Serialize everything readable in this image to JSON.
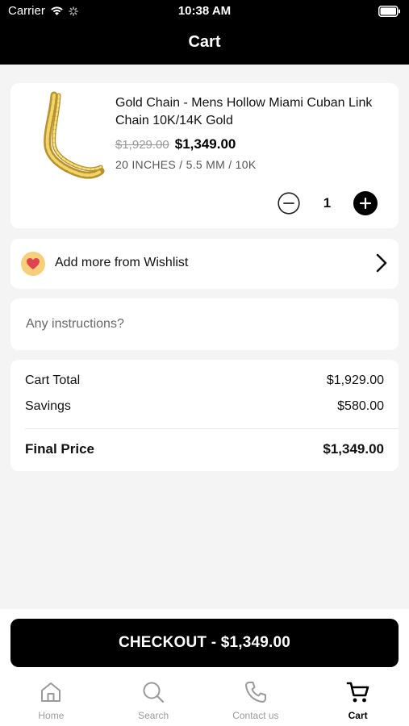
{
  "status_bar": {
    "carrier": "Carrier",
    "time": "10:38 AM"
  },
  "nav": {
    "title": "Cart"
  },
  "product": {
    "name": "Gold Chain - Mens Hollow Miami Cuban Link Chain 10K/14K Gold",
    "original_price": "$1,929.00",
    "sale_price": "$1,349.00",
    "variant": "20 INCHES / 5.5 MM / 10K",
    "quantity": "1"
  },
  "wishlist": {
    "label": "Add more from Wishlist"
  },
  "instructions": {
    "placeholder": "Any instructions?"
  },
  "summary": {
    "cart_total_label": "Cart Total",
    "cart_total_value": "$1,929.00",
    "savings_label": "Savings",
    "savings_value": "$580.00",
    "final_label": "Final Price",
    "final_value": "$1,349.00"
  },
  "checkout": {
    "label": "CHECKOUT - $1,349.00"
  },
  "tabs": [
    {
      "label": "Home",
      "icon": "home-icon",
      "active": false
    },
    {
      "label": "Search",
      "icon": "search-icon",
      "active": false
    },
    {
      "label": "Contact us",
      "icon": "phone-icon",
      "active": false
    },
    {
      "label": "Cart",
      "icon": "cart-icon",
      "active": true
    }
  ],
  "colors": {
    "header": "#000000",
    "accent_heart_bg": "#f6cf7b",
    "heart": "#e0454f",
    "gold": "#d4b24a"
  }
}
